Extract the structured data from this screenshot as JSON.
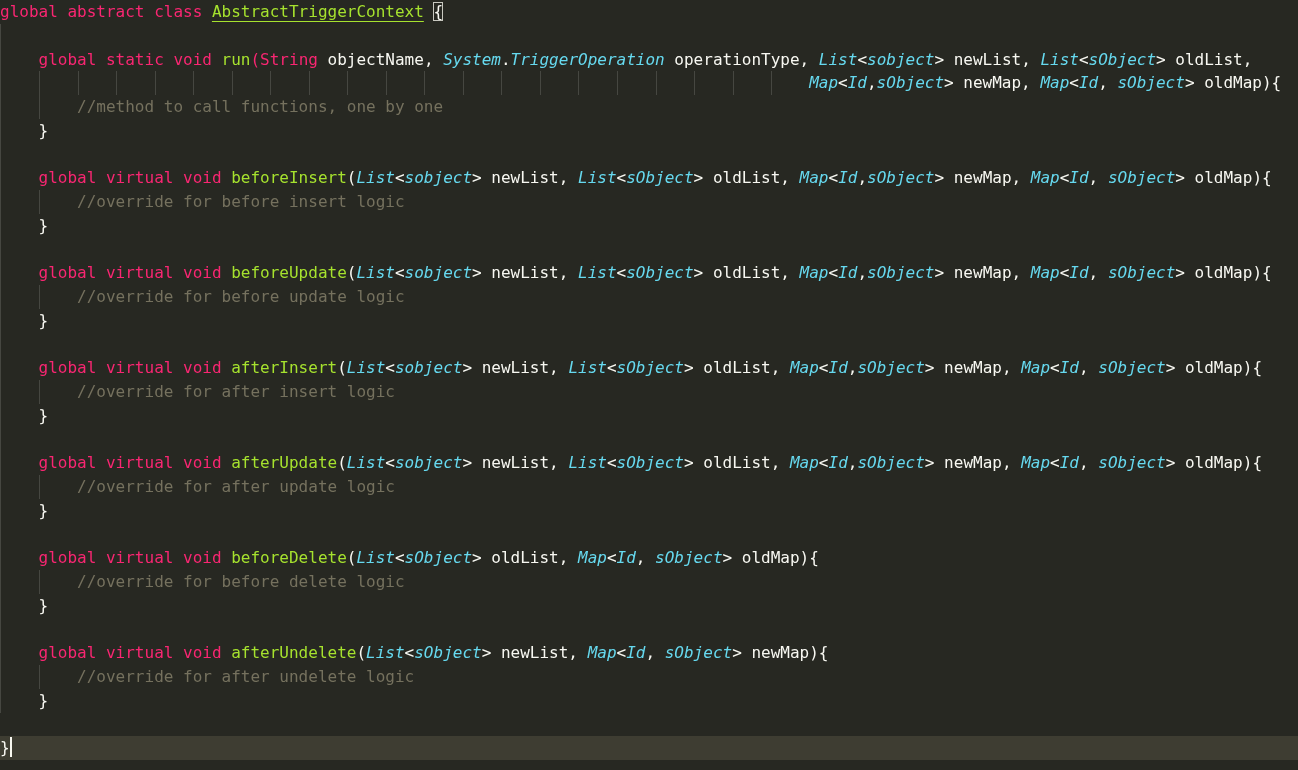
{
  "editor": {
    "lines": [
      {
        "current": false,
        "tokens": [
          {
            "kind": "keyword",
            "text": "global abstract class "
          },
          {
            "kind": "class-name",
            "text": "AbstractTriggerContext"
          },
          {
            "kind": "bracket-match",
            "text": " {"
          }
        ]
      },
      {
        "current": false
      },
      {
        "current": false,
        "tokens": [
          {
            "kind": "keyword",
            "text": "    global static void "
          },
          {
            "kind": "function",
            "text": "run"
          },
          {
            "kind": "keyword",
            "text": "(String"
          },
          {
            "kind": "plain",
            "text": " objectName, "
          },
          {
            "kind": "type",
            "text": "System"
          },
          {
            "kind": "plain",
            "text": "."
          },
          {
            "kind": "type",
            "text": "TriggerOperation"
          },
          {
            "kind": "plain",
            "text": " operationType, "
          },
          {
            "kind": "type",
            "text": "List"
          },
          {
            "kind": "plain",
            "text": "<"
          },
          {
            "kind": "type",
            "text": "sobject"
          },
          {
            "kind": "plain",
            "text": "> newList, "
          },
          {
            "kind": "type",
            "text": "List"
          },
          {
            "kind": "plain",
            "text": "<"
          },
          {
            "kind": "type",
            "text": "sObject"
          },
          {
            "kind": "plain",
            "text": "> oldList,"
          }
        ]
      },
      {
        "current": false,
        "tokens": [
          {
            "kind": "type",
            "text": "                                                                                    Map"
          },
          {
            "kind": "plain",
            "text": "<"
          },
          {
            "kind": "type",
            "text": "Id"
          },
          {
            "kind": "plain",
            "text": ","
          },
          {
            "kind": "type",
            "text": "sObject"
          },
          {
            "kind": "plain",
            "text": "> newMap, "
          },
          {
            "kind": "type",
            "text": "Map"
          },
          {
            "kind": "plain",
            "text": "<"
          },
          {
            "kind": "type",
            "text": "Id"
          },
          {
            "kind": "plain",
            "text": ", "
          },
          {
            "kind": "type",
            "text": "sObject"
          },
          {
            "kind": "plain",
            "text": "> oldMap){"
          }
        ]
      },
      {
        "current": false,
        "tokens": [
          {
            "kind": "comment",
            "text": "        //method to call functions, one by one"
          }
        ]
      },
      {
        "current": false,
        "tokens": [
          {
            "kind": "plain",
            "text": "    }"
          }
        ]
      },
      {
        "current": false
      },
      {
        "current": false,
        "tokens": [
          {
            "kind": "keyword",
            "text": "    global virtual void "
          },
          {
            "kind": "function",
            "text": "beforeInsert"
          },
          {
            "kind": "plain",
            "text": "("
          },
          {
            "kind": "type",
            "text": "List"
          },
          {
            "kind": "plain",
            "text": "<"
          },
          {
            "kind": "type",
            "text": "sobject"
          },
          {
            "kind": "plain",
            "text": "> newList, "
          },
          {
            "kind": "type",
            "text": "List"
          },
          {
            "kind": "plain",
            "text": "<"
          },
          {
            "kind": "type",
            "text": "sObject"
          },
          {
            "kind": "plain",
            "text": "> oldList, "
          },
          {
            "kind": "type",
            "text": "Map"
          },
          {
            "kind": "plain",
            "text": "<"
          },
          {
            "kind": "type",
            "text": "Id"
          },
          {
            "kind": "plain",
            "text": ","
          },
          {
            "kind": "type",
            "text": "sObject"
          },
          {
            "kind": "plain",
            "text": "> newMap, "
          },
          {
            "kind": "type",
            "text": "Map"
          },
          {
            "kind": "plain",
            "text": "<"
          },
          {
            "kind": "type",
            "text": "Id"
          },
          {
            "kind": "plain",
            "text": ", "
          },
          {
            "kind": "type",
            "text": "sObject"
          },
          {
            "kind": "plain",
            "text": "> oldMap){"
          }
        ]
      },
      {
        "current": false,
        "tokens": [
          {
            "kind": "comment",
            "text": "        //override for before insert logic"
          }
        ]
      },
      {
        "current": false,
        "tokens": [
          {
            "kind": "plain",
            "text": "    }"
          }
        ]
      },
      {
        "current": false
      },
      {
        "current": false,
        "tokens": [
          {
            "kind": "keyword",
            "text": "    global virtual void "
          },
          {
            "kind": "function",
            "text": "beforeUpdate"
          },
          {
            "kind": "plain",
            "text": "("
          },
          {
            "kind": "type",
            "text": "List"
          },
          {
            "kind": "plain",
            "text": "<"
          },
          {
            "kind": "type",
            "text": "sobject"
          },
          {
            "kind": "plain",
            "text": "> newList, "
          },
          {
            "kind": "type",
            "text": "List"
          },
          {
            "kind": "plain",
            "text": "<"
          },
          {
            "kind": "type",
            "text": "sObject"
          },
          {
            "kind": "plain",
            "text": "> oldList, "
          },
          {
            "kind": "type",
            "text": "Map"
          },
          {
            "kind": "plain",
            "text": "<"
          },
          {
            "kind": "type",
            "text": "Id"
          },
          {
            "kind": "plain",
            "text": ","
          },
          {
            "kind": "type",
            "text": "sObject"
          },
          {
            "kind": "plain",
            "text": "> newMap, "
          },
          {
            "kind": "type",
            "text": "Map"
          },
          {
            "kind": "plain",
            "text": "<"
          },
          {
            "kind": "type",
            "text": "Id"
          },
          {
            "kind": "plain",
            "text": ", "
          },
          {
            "kind": "type",
            "text": "sObject"
          },
          {
            "kind": "plain",
            "text": "> oldMap){"
          }
        ]
      },
      {
        "current": false,
        "tokens": [
          {
            "kind": "comment",
            "text": "        //override for before update logic"
          }
        ]
      },
      {
        "current": false,
        "tokens": [
          {
            "kind": "plain",
            "text": "    }"
          }
        ]
      },
      {
        "current": false
      },
      {
        "current": false,
        "tokens": [
          {
            "kind": "keyword",
            "text": "    global virtual void "
          },
          {
            "kind": "function",
            "text": "afterInsert"
          },
          {
            "kind": "plain",
            "text": "("
          },
          {
            "kind": "type",
            "text": "List"
          },
          {
            "kind": "plain",
            "text": "<"
          },
          {
            "kind": "type",
            "text": "sobject"
          },
          {
            "kind": "plain",
            "text": "> newList, "
          },
          {
            "kind": "type",
            "text": "List"
          },
          {
            "kind": "plain",
            "text": "<"
          },
          {
            "kind": "type",
            "text": "sObject"
          },
          {
            "kind": "plain",
            "text": "> oldList, "
          },
          {
            "kind": "type",
            "text": "Map"
          },
          {
            "kind": "plain",
            "text": "<"
          },
          {
            "kind": "type",
            "text": "Id"
          },
          {
            "kind": "plain",
            "text": ","
          },
          {
            "kind": "type",
            "text": "sObject"
          },
          {
            "kind": "plain",
            "text": "> newMap, "
          },
          {
            "kind": "type",
            "text": "Map"
          },
          {
            "kind": "plain",
            "text": "<"
          },
          {
            "kind": "type",
            "text": "Id"
          },
          {
            "kind": "plain",
            "text": ", "
          },
          {
            "kind": "type",
            "text": "sObject"
          },
          {
            "kind": "plain",
            "text": "> oldMap){"
          }
        ]
      },
      {
        "current": false,
        "tokens": [
          {
            "kind": "comment",
            "text": "        //override for after insert logic"
          }
        ]
      },
      {
        "current": false,
        "tokens": [
          {
            "kind": "plain",
            "text": "    }"
          }
        ]
      },
      {
        "current": false
      },
      {
        "current": false,
        "tokens": [
          {
            "kind": "keyword",
            "text": "    global virtual void "
          },
          {
            "kind": "function",
            "text": "afterUpdate"
          },
          {
            "kind": "plain",
            "text": "("
          },
          {
            "kind": "type",
            "text": "List"
          },
          {
            "kind": "plain",
            "text": "<"
          },
          {
            "kind": "type",
            "text": "sobject"
          },
          {
            "kind": "plain",
            "text": "> newList, "
          },
          {
            "kind": "type",
            "text": "List"
          },
          {
            "kind": "plain",
            "text": "<"
          },
          {
            "kind": "type",
            "text": "sObject"
          },
          {
            "kind": "plain",
            "text": "> oldList, "
          },
          {
            "kind": "type",
            "text": "Map"
          },
          {
            "kind": "plain",
            "text": "<"
          },
          {
            "kind": "type",
            "text": "Id"
          },
          {
            "kind": "plain",
            "text": ","
          },
          {
            "kind": "type",
            "text": "sObject"
          },
          {
            "kind": "plain",
            "text": "> newMap, "
          },
          {
            "kind": "type",
            "text": "Map"
          },
          {
            "kind": "plain",
            "text": "<"
          },
          {
            "kind": "type",
            "text": "Id"
          },
          {
            "kind": "plain",
            "text": ", "
          },
          {
            "kind": "type",
            "text": "sObject"
          },
          {
            "kind": "plain",
            "text": "> oldMap){"
          }
        ]
      },
      {
        "current": false,
        "tokens": [
          {
            "kind": "comment",
            "text": "        //override for after update logic"
          }
        ]
      },
      {
        "current": false,
        "tokens": [
          {
            "kind": "plain",
            "text": "    }"
          }
        ]
      },
      {
        "current": false
      },
      {
        "current": false,
        "tokens": [
          {
            "kind": "keyword",
            "text": "    global virtual void "
          },
          {
            "kind": "function",
            "text": "beforeDelete"
          },
          {
            "kind": "plain",
            "text": "("
          },
          {
            "kind": "type",
            "text": "List"
          },
          {
            "kind": "plain",
            "text": "<"
          },
          {
            "kind": "type",
            "text": "sObject"
          },
          {
            "kind": "plain",
            "text": "> oldList, "
          },
          {
            "kind": "type",
            "text": "Map"
          },
          {
            "kind": "plain",
            "text": "<"
          },
          {
            "kind": "type",
            "text": "Id"
          },
          {
            "kind": "plain",
            "text": ", "
          },
          {
            "kind": "type",
            "text": "sObject"
          },
          {
            "kind": "plain",
            "text": "> oldMap){"
          }
        ]
      },
      {
        "current": false,
        "tokens": [
          {
            "kind": "comment",
            "text": "        //override for before delete logic"
          }
        ]
      },
      {
        "current": false,
        "tokens": [
          {
            "kind": "plain",
            "text": "    }"
          }
        ]
      },
      {
        "current": false
      },
      {
        "current": false,
        "tokens": [
          {
            "kind": "keyword",
            "text": "    global virtual void "
          },
          {
            "kind": "function",
            "text": "afterUndelete"
          },
          {
            "kind": "plain",
            "text": "("
          },
          {
            "kind": "type",
            "text": "List"
          },
          {
            "kind": "plain",
            "text": "<"
          },
          {
            "kind": "type",
            "text": "sObject"
          },
          {
            "kind": "plain",
            "text": "> newList, "
          },
          {
            "kind": "type",
            "text": "Map"
          },
          {
            "kind": "plain",
            "text": "<"
          },
          {
            "kind": "type",
            "text": "Id"
          },
          {
            "kind": "plain",
            "text": ", "
          },
          {
            "kind": "type",
            "text": "sObject"
          },
          {
            "kind": "plain",
            "text": "> newMap){"
          }
        ]
      },
      {
        "current": false,
        "tokens": [
          {
            "kind": "comment",
            "text": "        //override for after undelete logic"
          }
        ]
      },
      {
        "current": false,
        "tokens": [
          {
            "kind": "plain",
            "text": "    }"
          }
        ]
      },
      {
        "current": false
      },
      {
        "current": true,
        "tokens": [
          {
            "kind": "plain",
            "text": "}"
          }
        ]
      }
    ]
  }
}
